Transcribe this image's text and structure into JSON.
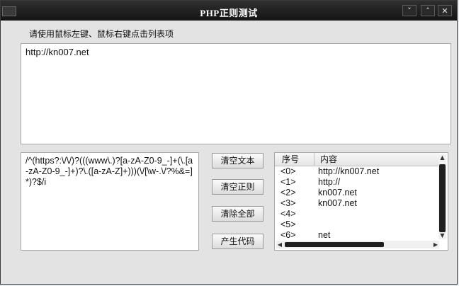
{
  "window": {
    "title": "PHP正则测试",
    "menu_glyph": "˅",
    "maximize_glyph": "˄",
    "close_glyph": "✕"
  },
  "instruction": "请使用鼠标左键、鼠标右键点击列表项",
  "input_text": "http://kn007.net",
  "regex_text": "/^(https?:\\/\\/)?(((www\\.)?[a-zA-Z0-9_-]+(\\.[a-zA-Z0-9_-]+)?\\.([a-zA-Z]+)))(\\/[\\w-.\\/?%&=]*)?$/i",
  "buttons": {
    "clear_text": "清空文本",
    "clear_regex": "清空正则",
    "clear_all": "清除全部",
    "gen_code": "产生代码"
  },
  "list": {
    "columns": [
      "序号",
      "内容"
    ],
    "rows": [
      {
        "index": "<0>",
        "value": "http://kn007.net"
      },
      {
        "index": "<1>",
        "value": "http://"
      },
      {
        "index": "<2>",
        "value": "kn007.net"
      },
      {
        "index": "<3>",
        "value": "kn007.net"
      },
      {
        "index": "<4>",
        "value": ""
      },
      {
        "index": "<5>",
        "value": ""
      },
      {
        "index": "<6>",
        "value": "net"
      }
    ]
  }
}
